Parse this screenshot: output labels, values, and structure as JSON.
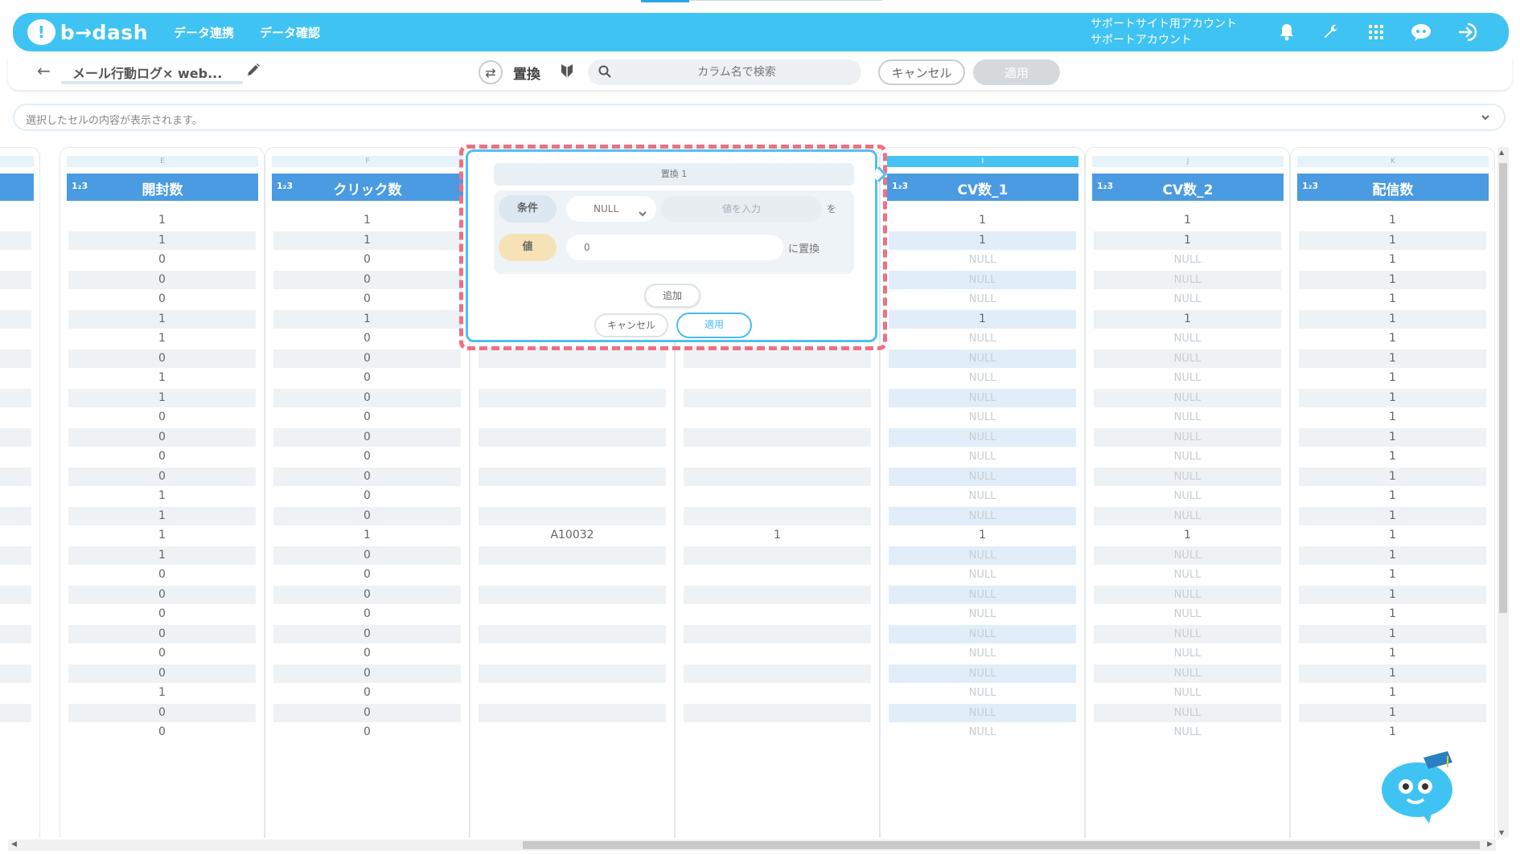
{
  "header": {
    "logo_text": "b→dash",
    "nav": [
      "データ連携",
      "データ確認"
    ],
    "account_line1": "サポートサイト用アカウント",
    "account_line2": "サポートアカウント",
    "icons": [
      "bell-icon",
      "wrench-icon",
      "grid-icon",
      "chat-icon",
      "logout-icon"
    ],
    "brand_color": "#3fc3f3"
  },
  "toolbar": {
    "dataset_name": "メール行動ログ× web...",
    "mode_label": "置換",
    "search_placeholder": "カラム名で検索",
    "cancel_label": "キャンセル",
    "apply_label": "適用"
  },
  "cell_preview": {
    "placeholder": "選択したセルの内容が表示されます。"
  },
  "columns": [
    {
      "letter": "E",
      "type": "1₂3",
      "name": "開封数",
      "active": false
    },
    {
      "letter": "F",
      "type": "1₂3",
      "name": "クリック数",
      "active": false
    },
    {
      "letter": "I",
      "type": "1₂3",
      "name": "CV数_1",
      "active": true
    },
    {
      "letter": "J",
      "type": "1₂3",
      "name": "CV数_2",
      "active": false
    },
    {
      "letter": "K",
      "type": "1₂3",
      "name": "配信数",
      "active": false
    }
  ],
  "rows": {
    "open": [
      "1",
      "1",
      "0",
      "0",
      "0",
      "1",
      "1",
      "0",
      "1",
      "1",
      "0",
      "0",
      "0",
      "0",
      "1",
      "1",
      "1",
      "1",
      "0",
      "0",
      "0",
      "0",
      "0",
      "0",
      "1",
      "0",
      "0"
    ],
    "click": [
      "1",
      "1",
      "0",
      "0",
      "0",
      "1",
      "0",
      "0",
      "0",
      "0",
      "0",
      "0",
      "0",
      "0",
      "0",
      "0",
      "1",
      "0",
      "0",
      "0",
      "0",
      "0",
      "0",
      "0",
      "0",
      "0",
      "0"
    ],
    "g": [
      "",
      "",
      "",
      "",
      "",
      "",
      "",
      "",
      "",
      "",
      "",
      "",
      "",
      "",
      "",
      "",
      "A10032",
      "",
      "",
      "",
      "",
      "",
      "",
      "",
      "",
      "",
      ""
    ],
    "h": [
      "",
      "",
      "",
      "",
      "",
      "",
      "",
      "",
      "",
      "",
      "",
      "",
      "",
      "",
      "",
      "",
      "1",
      "",
      "",
      "",
      "",
      "",
      "",
      "",
      "",
      "",
      ""
    ],
    "cv1": [
      "1",
      "1",
      "NULL",
      "NULL",
      "NULL",
      "1",
      "NULL",
      "NULL",
      "NULL",
      "NULL",
      "NULL",
      "NULL",
      "NULL",
      "NULL",
      "NULL",
      "NULL",
      "1",
      "NULL",
      "NULL",
      "NULL",
      "NULL",
      "NULL",
      "NULL",
      "NULL",
      "NULL",
      "NULL",
      "NULL"
    ],
    "cv2": [
      "1",
      "1",
      "NULL",
      "NULL",
      "NULL",
      "1",
      "NULL",
      "NULL",
      "NULL",
      "NULL",
      "NULL",
      "NULL",
      "NULL",
      "NULL",
      "NULL",
      "NULL",
      "1",
      "NULL",
      "NULL",
      "NULL",
      "NULL",
      "NULL",
      "NULL",
      "NULL",
      "NULL",
      "NULL",
      "NULL"
    ],
    "send": [
      "1",
      "1",
      "1",
      "1",
      "1",
      "1",
      "1",
      "1",
      "1",
      "1",
      "1",
      "1",
      "1",
      "1",
      "1",
      "1",
      "1",
      "1",
      "1",
      "1",
      "1",
      "1",
      "1",
      "1",
      "1",
      "1",
      "1"
    ]
  },
  "replace_popup": {
    "title": "置換 1",
    "condition_label": "条件",
    "condition_value": "NULL",
    "condition_input_placeholder": "値を入力",
    "wo": "を",
    "value_label": "値",
    "value": "0",
    "replace_suffix": "に置換",
    "add_label": "追加",
    "cancel_label": "キャンセル",
    "apply_label": "適用"
  }
}
